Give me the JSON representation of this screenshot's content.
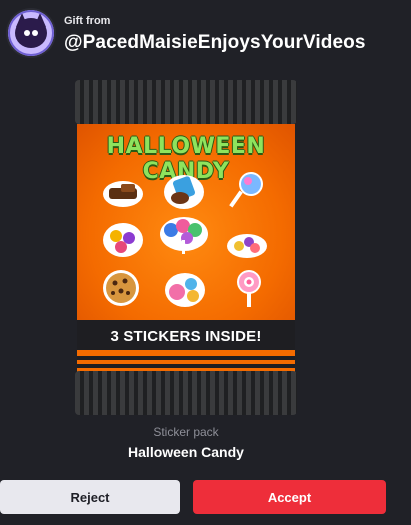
{
  "header": {
    "gift_label": "Gift from",
    "sender": "@PacedMaisieEnjoysYourVideos"
  },
  "pack": {
    "title": "HALLOWEEN CANDY",
    "banner": "3 STICKERS INSIDE!",
    "stickers": [
      "chocolate-bar-icon",
      "candy-bag-icon",
      "blue-lollipop-icon",
      "wrapped-candies-icon",
      "lollipop-bouquet-icon",
      "candy-pile-icon",
      "cookie-icon",
      "gumballs-icon",
      "swirl-lollipop-icon"
    ]
  },
  "item": {
    "kind": "Sticker pack",
    "name": "Halloween Candy"
  },
  "actions": {
    "reject_label": "Reject",
    "accept_label": "Accept"
  },
  "colors": {
    "background": "#202127",
    "accept": "#ee2e3a",
    "reject": "#e8e8ee",
    "pack_orange": "#f46b00",
    "title_green": "#8ee35d"
  }
}
